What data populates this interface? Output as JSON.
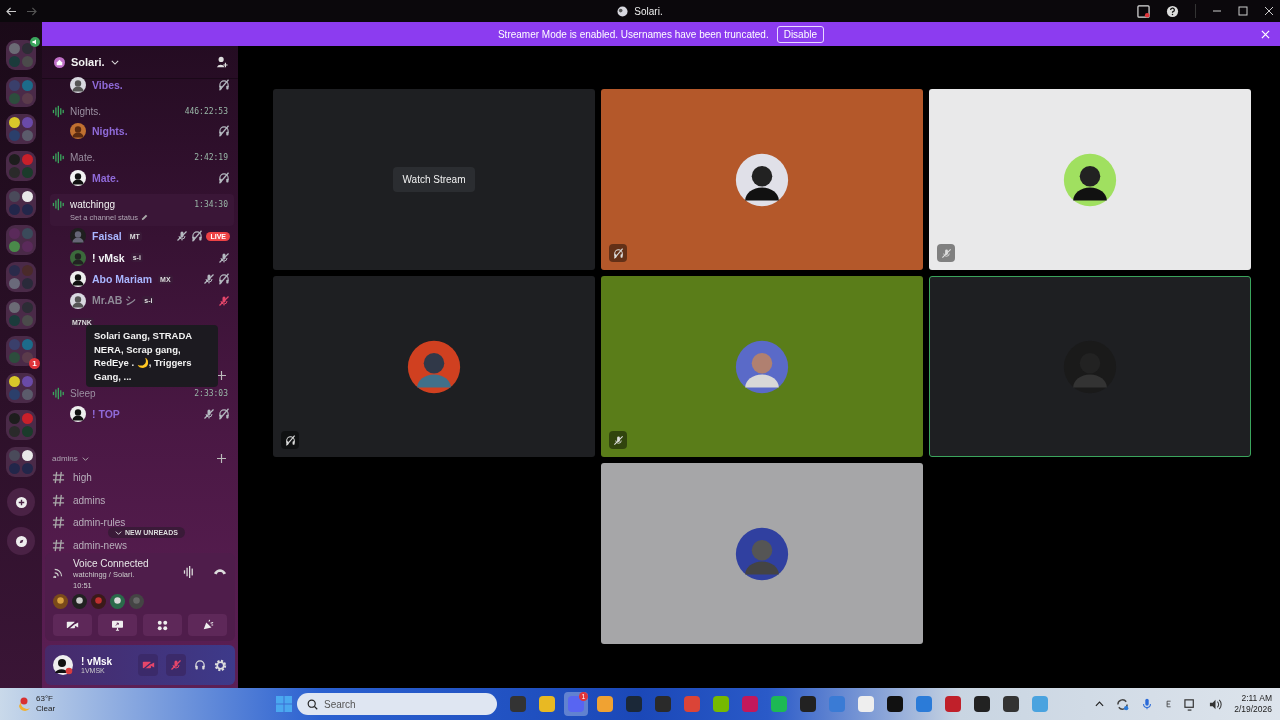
{
  "window": {
    "title": "Solari."
  },
  "banner": {
    "text": "Streamer Mode is enabled. Usernames have been truncated.",
    "button": "Disable"
  },
  "server_rail": {
    "items": [
      {
        "kind": "folder",
        "in_voice": true
      },
      {
        "kind": "folder",
        "in_voice": false
      },
      {
        "kind": "folder",
        "in_voice": false
      },
      {
        "kind": "folder",
        "in_voice": false
      },
      {
        "kind": "folder",
        "in_voice": false
      },
      {
        "kind": "folder",
        "in_voice": false
      },
      {
        "kind": "folder",
        "in_voice": false
      },
      {
        "kind": "folder",
        "in_voice": false
      },
      {
        "kind": "folder",
        "in_voice": false,
        "badge": "1"
      },
      {
        "kind": "folder",
        "in_voice": false
      },
      {
        "kind": "folder",
        "in_voice": false
      },
      {
        "kind": "folder",
        "in_voice": false
      },
      {
        "kind": "add"
      },
      {
        "kind": "discover"
      }
    ]
  },
  "server": {
    "name": "Solari."
  },
  "channel_list": [
    {
      "kind": "voice",
      "members": [
        {
          "name": "Vibes.",
          "color": "#8f6ad8",
          "muted": false,
          "server_muted": false,
          "deafened": true
        }
      ]
    },
    {
      "kind": "voice",
      "name": "Nights.",
      "duration": "446:22:53",
      "selected": false,
      "members": [
        {
          "name": "Nights.",
          "color": "#8f6ad8",
          "muted": false,
          "server_muted": false,
          "deafened": true
        }
      ]
    },
    {
      "kind": "voice",
      "name": "Mate.",
      "duration": "2:42:19",
      "selected": false,
      "members": [
        {
          "name": "Mate.",
          "color": "#8f6ad8",
          "muted": false,
          "server_muted": false,
          "deafened": true
        }
      ]
    },
    {
      "kind": "voice",
      "name": "watchingg",
      "duration": "1:34:30",
      "status": "Set a channel status",
      "selected": true,
      "members": [
        {
          "name": "Faisal",
          "tag": "MT",
          "color": "#a9b6ff",
          "muted": true,
          "server_muted": false,
          "deafened": true,
          "live": "LIVE"
        },
        {
          "name": "! vMsk",
          "tag": "s-i",
          "color": "#f2f3f5",
          "muted": true,
          "server_muted": false,
          "deafened": false
        },
        {
          "name": "Abo Mariam",
          "tag": "MX",
          "color": "#a9b6ff",
          "muted": true,
          "server_muted": false,
          "deafened": true
        },
        {
          "name": "Mr.AB シ",
          "tag": "s-i",
          "color": "#8e8a96",
          "muted": false,
          "server_muted": true,
          "deafened": false
        },
        {
          "tag": "M7NK",
          "muted": false,
          "server_muted": false,
          "deafened": false
        }
      ]
    },
    {
      "kind": "category"
    },
    {
      "kind": "voice",
      "name": "Sleep",
      "duration": "2:33:03",
      "selected": false,
      "members": [
        {
          "name": "! TOP",
          "color": "#8f6ad8",
          "muted": true,
          "server_muted": false,
          "deafened": true
        }
      ]
    },
    {
      "kind": "category",
      "name": "admins"
    },
    {
      "kind": "text",
      "name": "high"
    },
    {
      "kind": "text",
      "name": "admins"
    },
    {
      "kind": "text",
      "name": "admin-rules"
    },
    {
      "kind": "text",
      "name": "admin-news"
    }
  ],
  "tooltip": {
    "text": "Solari Gang, STRADA NERA, Scrap gang, RedEye . 🌙, Triggers Gang, ..."
  },
  "unreads_pill": "NEW UNREADS",
  "voice_panel": {
    "title": "Voice Connected",
    "channel": "watchingg / Solari.",
    "elapsed": "10:51"
  },
  "user_panel": {
    "name": "! vMsk",
    "status": "1VMSK",
    "camera_off": true,
    "mic_muted": true
  },
  "tiles": [
    {
      "kind": "stream",
      "button": "Watch Stream",
      "color": "#1e1f22",
      "speaking": false
    },
    {
      "kind": "avatar",
      "color": "#b4582a",
      "muted": false,
      "deafened": true,
      "speaking": false
    },
    {
      "kind": "avatar",
      "color": "#e9e9ea",
      "muted": true,
      "deafened": false,
      "speaking": false
    },
    {
      "kind": "avatar",
      "color": "#1e1f22",
      "muted": false,
      "deafened": true,
      "speaking": false
    },
    {
      "kind": "avatar",
      "color": "#5a7d19",
      "muted": true,
      "deafened": false,
      "speaking": false
    },
    {
      "kind": "avatar",
      "color": "#1e1f22",
      "muted": false,
      "deafened": false,
      "speaking": true
    },
    {
      "kind": "avatar",
      "color": "#a6a6a8",
      "muted": false,
      "deafened": false,
      "speaking": false
    }
  ],
  "taskbar": {
    "weather": {
      "temperature": "63°F",
      "condition": "Clear"
    },
    "search": {
      "placeholder": "Search"
    },
    "apps": [
      {
        "active": false
      },
      {
        "active": false
      },
      {
        "active": true,
        "badge": "1"
      },
      {
        "active": false
      },
      {
        "active": false
      },
      {
        "active": false
      },
      {
        "active": false
      },
      {
        "active": false
      },
      {
        "active": false
      },
      {
        "active": false
      },
      {
        "active": false
      },
      {
        "active": false
      },
      {
        "active": false
      },
      {
        "active": false
      },
      {
        "active": false
      },
      {
        "active": false
      },
      {
        "active": false
      },
      {
        "active": false
      },
      {
        "active": false
      }
    ],
    "time": "2:11 AM",
    "date": "2/19/2026"
  }
}
